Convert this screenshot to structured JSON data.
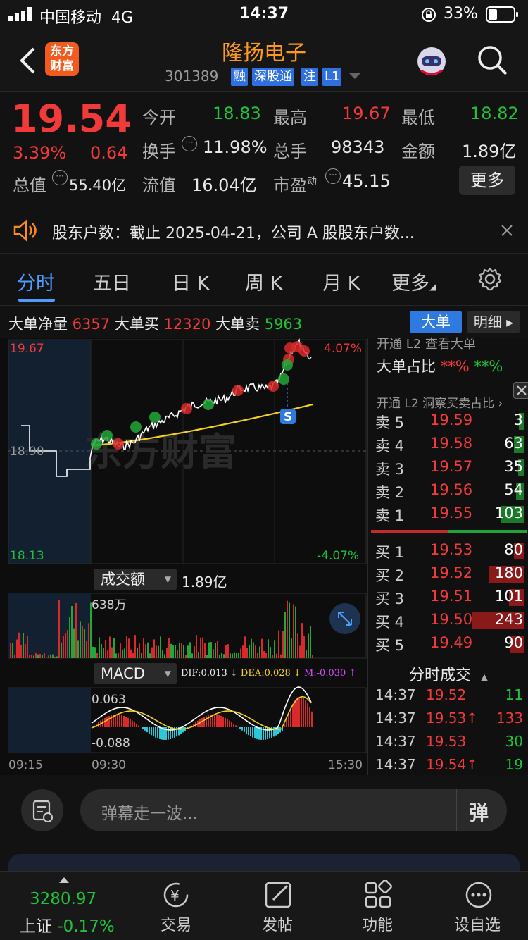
{
  "status": {
    "carrier": "中国移动",
    "network": "4G",
    "time": "14:37",
    "battery": "33%"
  },
  "header": {
    "title": "隆扬电子",
    "code": "301389",
    "tags": [
      "融",
      "深股通",
      "注",
      "L1"
    ],
    "logo_line1": "东方",
    "logo_line2": "财富"
  },
  "quote": {
    "price": "19.54",
    "change_pct": "3.39%",
    "change": "0.64",
    "open_label": "今开",
    "open": "18.83",
    "high_label": "最高",
    "high": "19.67",
    "low_label": "最低",
    "low": "18.82",
    "turnover_label": "换手",
    "turnover": "11.98%",
    "volume_label": "总手",
    "volume": "98343",
    "amount_label": "金额",
    "amount": "1.89亿",
    "mktcap_label": "总值",
    "mktcap": "55.40亿",
    "float_label": "流值",
    "float": "16.04亿",
    "pe_label": "市盈",
    "pe_sup": "动",
    "pe": "45.15",
    "more_label": "更多"
  },
  "news": {
    "text": "股东户数：截止 2025-04-21，公司 A 股股东户数..."
  },
  "tabs": [
    "分时",
    "五日",
    "日 K",
    "周 K",
    "月 K",
    "更多"
  ],
  "bigorder": {
    "net_label": "大单净量",
    "net": "6357",
    "buy_label": "大单买",
    "buy": "12320",
    "sell_label": "大单卖",
    "sell": "5963",
    "btn_big": "大单",
    "btn_detail": "明细"
  },
  "chart": {
    "y_top": "19.67",
    "y_mid": "18.90",
    "y_bottom": "18.13",
    "pct_top": "4.07%",
    "pct_bottom": "-4.07%",
    "watermark": "东方财富",
    "volume_selector": "成交额",
    "volume_total": "1.89亿",
    "volume_max": "638万",
    "macd_selector": "MACD",
    "dif": "DIF:0.013",
    "dea": "DEA:0.028",
    "m": "M:-0.030",
    "macd_top": "0.063",
    "macd_bottom": "-0.088",
    "t_start": "09:15",
    "t_open": "09:30",
    "t_end": "15:30"
  },
  "l2_box": {
    "title": "大单占比",
    "buy": "**%",
    "sell": "**%",
    "hint_top": "开通 L2 查看大单",
    "hint": "开通 L2 洞察买卖占比"
  },
  "asks": [
    {
      "side": "卖 5",
      "price": "19.59",
      "vol": "3",
      "bar": 0.02
    },
    {
      "side": "卖 4",
      "price": "19.58",
      "vol": "63",
      "bar": 0.1
    },
    {
      "side": "卖 3",
      "price": "19.57",
      "vol": "35",
      "bar": 0.06
    },
    {
      "side": "卖 2",
      "price": "19.56",
      "vol": "54",
      "bar": 0.08
    },
    {
      "side": "卖 1",
      "price": "19.55",
      "vol": "103",
      "bar": 0.22
    }
  ],
  "bids": [
    {
      "side": "买 1",
      "price": "19.53",
      "vol": "80",
      "bar": 0.1
    },
    {
      "side": "买 2",
      "price": "19.52",
      "vol": "180",
      "bar": 0.34
    },
    {
      "side": "买 3",
      "price": "19.51",
      "vol": "101",
      "bar": 0.15
    },
    {
      "side": "买 4",
      "price": "19.50",
      "vol": "243",
      "bar": 0.5
    },
    {
      "side": "买 5",
      "price": "19.49",
      "vol": "90",
      "bar": 0.14
    }
  ],
  "ticks_header": "分时成交",
  "ticks": [
    {
      "t": "14:37",
      "p": "19.52",
      "v": "11",
      "dir": "buy"
    },
    {
      "t": "14:37",
      "p": "19.53↑",
      "v": "133",
      "dir": "sell"
    },
    {
      "t": "14:37",
      "p": "19.53",
      "v": "30",
      "dir": "buy"
    },
    {
      "t": "14:37",
      "p": "19.54↑",
      "v": "19",
      "dir": "buy"
    }
  ],
  "danmu": {
    "placeholder": "弹幕走一波...",
    "btn": "弹"
  },
  "tabbar": {
    "index_value": "3280.97",
    "index_name": "上证",
    "index_change": "-0.17%",
    "items": [
      "交易",
      "发帖",
      "功能",
      "设自选"
    ]
  },
  "colors": {
    "up": "#f23a3a",
    "down": "#21c23a",
    "accent": "#ff9a1e",
    "tag": "#2f6fe0"
  }
}
